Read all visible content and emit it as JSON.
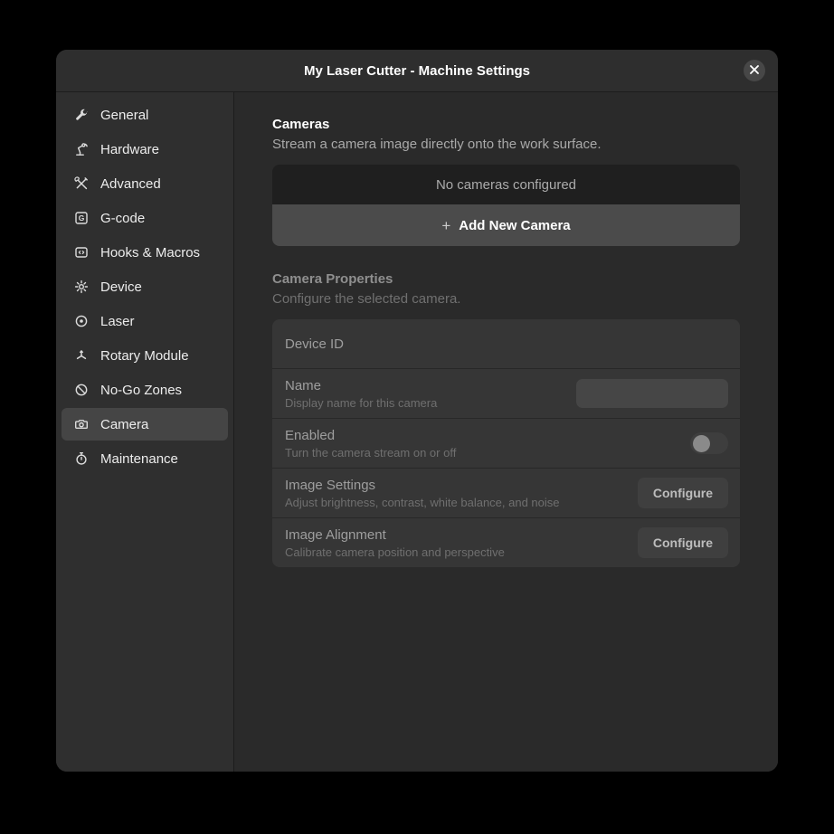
{
  "window": {
    "title": "My Laser Cutter - Machine Settings"
  },
  "sidebar": {
    "items": [
      {
        "label": "General",
        "icon": "wrench-icon",
        "selected": false
      },
      {
        "label": "Hardware",
        "icon": "robot-arm-icon",
        "selected": false
      },
      {
        "label": "Advanced",
        "icon": "crossed-tools-icon",
        "selected": false
      },
      {
        "label": "G-code",
        "icon": "gcode-icon",
        "selected": false
      },
      {
        "label": "Hooks & Macros",
        "icon": "code-brackets-icon",
        "selected": false
      },
      {
        "label": "Device",
        "icon": "gear-icon",
        "selected": false
      },
      {
        "label": "Laser",
        "icon": "target-icon",
        "selected": false
      },
      {
        "label": "Rotary Module",
        "icon": "rotary-icon",
        "selected": false
      },
      {
        "label": "No-Go Zones",
        "icon": "prohibition-icon",
        "selected": false
      },
      {
        "label": "Camera",
        "icon": "camera-icon",
        "selected": true
      },
      {
        "label": "Maintenance",
        "icon": "stopwatch-icon",
        "selected": false
      }
    ]
  },
  "content": {
    "cameras_section": {
      "title": "Cameras",
      "subtitle": "Stream a camera image directly onto the work surface.",
      "empty_text": "No cameras configured",
      "add_plus": "+",
      "add_button_label": "Add New Camera"
    },
    "properties_section": {
      "title": "Camera Properties",
      "subtitle": "Configure the selected camera.",
      "rows": [
        {
          "title": "Device ID"
        },
        {
          "title": "Name",
          "subtitle": "Display name for this camera",
          "value": "",
          "placeholder": ""
        },
        {
          "title": "Enabled",
          "subtitle": "Turn the camera stream on or off",
          "state": "off"
        },
        {
          "title": "Image Settings",
          "subtitle": "Adjust brightness, contrast, white balance, and noise",
          "button_label": "Configure"
        },
        {
          "title": "Image Alignment",
          "subtitle": "Calibrate camera position and perspective",
          "button_label": "Configure"
        }
      ]
    }
  },
  "colors": {
    "window_bg": "#2a2a2a",
    "header_bg": "#2e2e2e",
    "sidebar_bg": "#2f2f2f",
    "selected_item_bg": "#454545",
    "card_row_bg": "#363636",
    "empty_list_bg": "#1f1f1f",
    "add_button_bg": "#4b4b4b"
  }
}
